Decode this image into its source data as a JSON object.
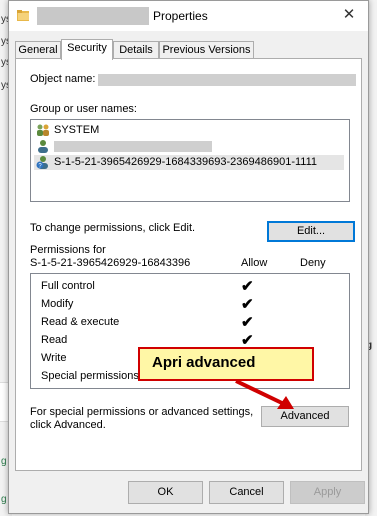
{
  "window": {
    "title": "Properties",
    "close": "✕"
  },
  "tabs": [
    "General",
    "Security",
    "Details",
    "Previous Versions"
  ],
  "security": {
    "object_name_label": "Object name:",
    "group_label": "Group or user names:",
    "users": [
      {
        "name": "SYSTEM",
        "icon": "users-group-icon"
      },
      {
        "name": "",
        "icon": "user-icon",
        "redacted": true
      },
      {
        "name": "S-1-5-21-3965426929-1684339693-2369486901-1111",
        "icon": "unknown-user-icon",
        "selected": true
      }
    ],
    "change_text": "To change permissions, click Edit.",
    "edit_label": "Edit...",
    "perm_for_label": "Permissions for",
    "perm_for_name": "S-1-5-21-3965426929-16843396",
    "allow_label": "Allow",
    "deny_label": "Deny",
    "permissions": [
      {
        "name": "Full control",
        "allow": true,
        "deny": false
      },
      {
        "name": "Modify",
        "allow": true,
        "deny": false
      },
      {
        "name": "Read & execute",
        "allow": true,
        "deny": false
      },
      {
        "name": "Read",
        "allow": true,
        "deny": false
      },
      {
        "name": "Write",
        "allow": false,
        "deny": false
      },
      {
        "name": "Special permissions",
        "allow": false,
        "deny": false
      }
    ],
    "special_text_1": "For special permissions or advanced settings,",
    "special_text_2": "click Advanced.",
    "advanced_label": "Advanced"
  },
  "footer": {
    "ok": "OK",
    "cancel": "Cancel",
    "apply": "Apply"
  },
  "callout": {
    "text": "Apri advanced",
    "border_color": "#d00000",
    "fill_color": "#fff7a6"
  },
  "background": {
    "left_frags": [
      "ys",
      "ys",
      "ys",
      "ys"
    ],
    "right_frags": [
      "g"
    ],
    "left_bottom": [
      "g",
      "g"
    ]
  },
  "check_glyph": "✔"
}
